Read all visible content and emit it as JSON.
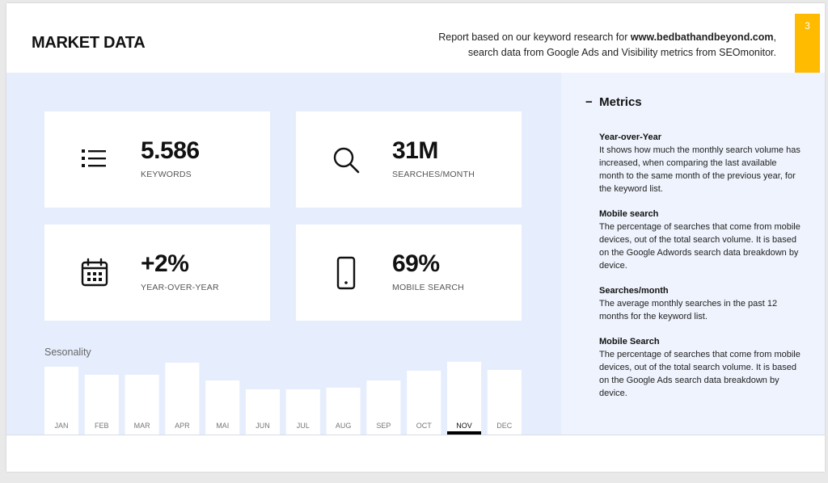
{
  "header": {
    "title": "MARKET DATA",
    "subtitle_prefix": "Report based on our keyword research for ",
    "subtitle_domain": "www.bedbathandbeyond.com",
    "subtitle_suffix": ",",
    "subtitle_line2": "search data from Google Ads and Visibility metrics from SEOmonitor.",
    "page_number": "3"
  },
  "stats": [
    {
      "value": "5.586",
      "label": "KEYWORDS",
      "icon": "list-icon"
    },
    {
      "value": "31M",
      "label": "SEARCHES/MONTH",
      "icon": "search-icon"
    },
    {
      "value": "+2%",
      "label": "YEAR-OVER-YEAR",
      "icon": "calendar-icon"
    },
    {
      "value": "69%",
      "label": "MOBILE SEARCH",
      "icon": "mobile-phone-icon"
    }
  ],
  "seasonality": {
    "title": "Sesonality",
    "highlight": "NOV"
  },
  "chart_data": {
    "type": "bar",
    "categories": [
      "JAN",
      "FEB",
      "MAR",
      "APR",
      "MAI",
      "JUN",
      "JUL",
      "AUG",
      "SEP",
      "OCT",
      "NOV",
      "DEC"
    ],
    "values": [
      84,
      74,
      74,
      89,
      67,
      56,
      56,
      58,
      67,
      79,
      90,
      80
    ],
    "ylim": [
      0,
      100
    ]
  },
  "metrics": {
    "heading": "Metrics",
    "items": [
      {
        "title": "Year-over-Year",
        "text": "It shows how much the monthly search volume has increased, when comparing the last available month to the same month of the previous year, for the keyword list."
      },
      {
        "title": "Mobile search",
        "text": "The percentage of searches that come from mobile devices, out of the total search volume. It is based on the Google Adwords search data breakdown by device."
      },
      {
        "title": "Searches/month",
        "text": "The average monthly searches in the past 12 months for the keyword list."
      },
      {
        "title": "Mobile Search",
        "text": "The percentage of searches that come from mobile devices, out of the total search volume. It is based on the Google Ads search data breakdown by device."
      }
    ]
  },
  "colors": {
    "accent": "#ffbb00",
    "panel": "#e6eefd",
    "bar": "#ffffff",
    "highlight": "#000000"
  }
}
